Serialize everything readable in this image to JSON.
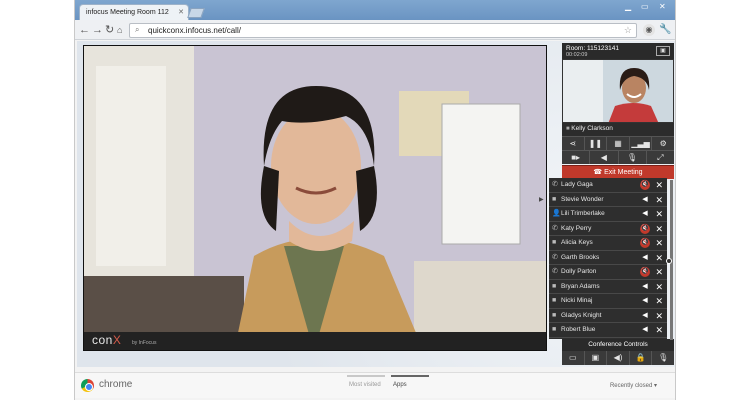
{
  "browser": {
    "tab_title": "infocus Meeting Room 112",
    "url": "quickconx.infocus.net/call/",
    "brand": "chrome",
    "new_tab_page": {
      "tabs": [
        "Most visited",
        "Apps"
      ],
      "active_tab": "Apps",
      "recently_closed": "Recently closed"
    }
  },
  "meeting": {
    "logo_text": "con",
    "logo_x": "X",
    "logo_by": "by InFocus",
    "room": "Room: 115123141",
    "elapsed": "00:02:09",
    "self_name": "Kelly Clarkson",
    "exit_label": "Exit Meeting",
    "conference_controls_label": "Conference Controls",
    "colors": {
      "exit": "#c0392b",
      "panel": "#2e2e2e"
    }
  },
  "participants": [
    {
      "name": "Lady Gaga",
      "icon": "phone-icon",
      "muted": true
    },
    {
      "name": "Stevie Wonder",
      "icon": "video-icon",
      "muted": false
    },
    {
      "name": "Lili Trimberlake",
      "icon": "user-add-icon",
      "muted": false
    },
    {
      "name": "Katy Perry",
      "icon": "phone-icon",
      "muted": true
    },
    {
      "name": "Alicia Keys",
      "icon": "video-icon",
      "muted": true
    },
    {
      "name": "Garth Brooks",
      "icon": "phone-icon",
      "muted": false
    },
    {
      "name": "Dolly Parton",
      "icon": "phone-icon",
      "muted": true
    },
    {
      "name": "Bryan Adams",
      "icon": "video-icon",
      "muted": false
    },
    {
      "name": "Nicki Minaj",
      "icon": "video-icon",
      "muted": false
    },
    {
      "name": "Gladys Knight",
      "icon": "video-icon",
      "muted": false
    },
    {
      "name": "Robert Blue",
      "icon": "video-icon",
      "muted": false
    }
  ]
}
